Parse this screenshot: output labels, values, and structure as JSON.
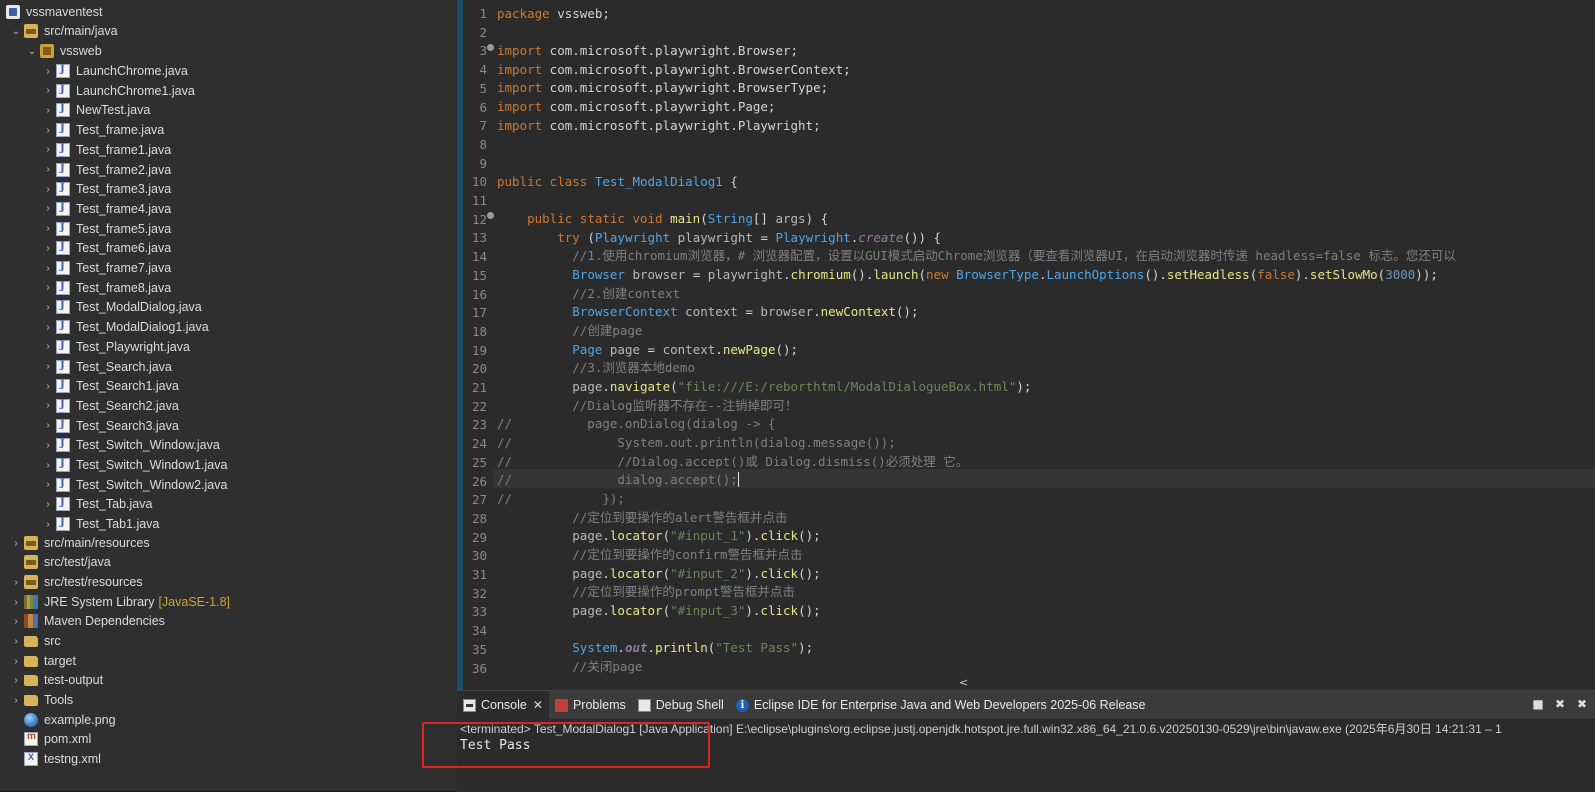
{
  "explorer": {
    "project": "vssmaventest",
    "src_main_java": "src/main/java",
    "package": "vssweb",
    "files": [
      "LaunchChrome.java",
      "LaunchChrome1.java",
      "NewTest.java",
      "Test_frame.java",
      "Test_frame1.java",
      "Test_frame2.java",
      "Test_frame3.java",
      "Test_frame4.java",
      "Test_frame5.java",
      "Test_frame6.java",
      "Test_frame7.java",
      "Test_frame8.java",
      "Test_ModalDialog.java",
      "Test_ModalDialog1.java",
      "Test_Playwright.java",
      "Test_Search.java",
      "Test_Search1.java",
      "Test_Search2.java",
      "Test_Search3.java",
      "Test_Switch_Window.java",
      "Test_Switch_Window1.java",
      "Test_Switch_Window2.java",
      "Test_Tab.java",
      "Test_Tab1.java"
    ],
    "src_main_resources": "src/main/resources",
    "src_test_java": "src/test/java",
    "src_test_resources": "src/test/resources",
    "jre_library": "JRE System Library",
    "jre_decoration": "[JavaSE-1.8]",
    "maven_deps": "Maven Dependencies",
    "src": "src",
    "target": "target",
    "test_output": "test-output",
    "tools": "Tools",
    "example_png": "example.png",
    "pom_xml": "pom.xml",
    "testng_xml": "testng.xml"
  },
  "editor": {
    "line_numbers": [
      "1",
      "2",
      "3",
      "4",
      "5",
      "6",
      "7",
      "8",
      "9",
      "10",
      "11",
      "12",
      "13",
      "14",
      "15",
      "16",
      "17",
      "18",
      "19",
      "20",
      "21",
      "22",
      "23",
      "24",
      "25",
      "26",
      "27",
      "28",
      "29",
      "30",
      "31",
      "32",
      "33",
      "34",
      "35",
      "36"
    ],
    "scroll_left": "<"
  },
  "console": {
    "tabs": {
      "console": "Console",
      "problems": "Problems",
      "debug_shell": "Debug Shell",
      "eclipse_info": "Eclipse IDE for Enterprise Java and Web Developers 2025-06 Release"
    },
    "terminated": "<terminated> Test_ModalDialog1 [Java Application] E:\\eclipse\\plugins\\org.eclipse.justj.openjdk.hotspot.jre.full.win32.x86_64_21.0.6.v20250130-0529\\jre\\bin\\javaw.exe  (2025年6月30日 14:21:31 – 1",
    "output": "Test Pass"
  }
}
